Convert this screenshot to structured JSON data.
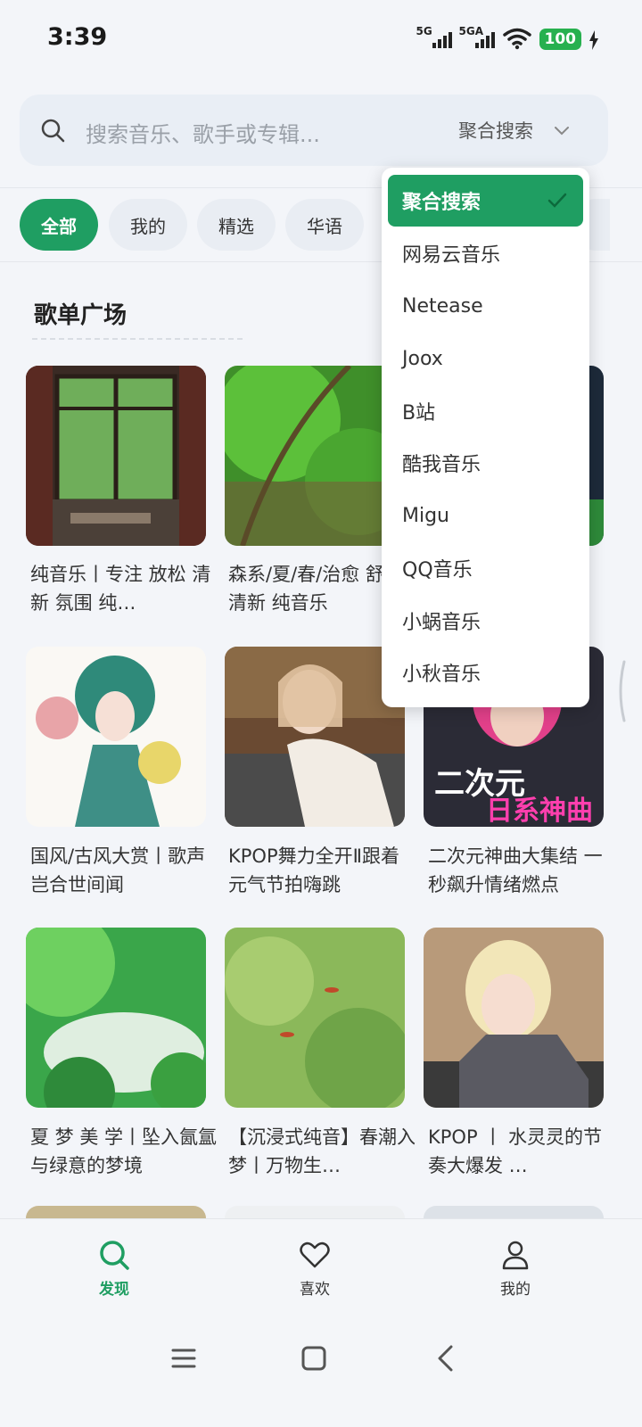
{
  "status_bar": {
    "time": "3:39",
    "signal_1_label": "5G",
    "signal_2_label": "5GA",
    "battery": "100",
    "icons": [
      "signal-icon",
      "signal-icon",
      "wifi-icon",
      "battery-icon",
      "charging-icon"
    ]
  },
  "search": {
    "placeholder": "搜索音乐、歌手或专辑...",
    "source_label": "聚合搜索"
  },
  "tabs": [
    "全部",
    "我的",
    "精选",
    "华语"
  ],
  "section": {
    "title": "歌单广场"
  },
  "playlists": [
    {
      "title": "纯音乐丨专注 放松 清新 氛围 纯…"
    },
    {
      "title": "森系/夏/春/治愈 舒缓 清新 纯音乐"
    },
    {
      "title": ""
    },
    {
      "title": "国风/古风大赏丨歌声岂合世间闻"
    },
    {
      "title": "KPOP舞力全开Ⅱ跟着元气节拍嗨跳"
    },
    {
      "title": "二次元神曲大集结 一秒飙升情绪燃点"
    },
    {
      "title": "夏 梦 美 学丨坠入氤氲与绿意的梦境"
    },
    {
      "title": "【沉浸式纯音】春潮入梦丨万物生…"
    },
    {
      "title": "KPOP 丨 水灵灵的节奏大爆发 …"
    }
  ],
  "cover_text": {
    "line1": "二次元",
    "line2": "日系神曲"
  },
  "dropdown": {
    "options": [
      "聚合搜索",
      "网易云音乐",
      "Netease",
      "Joox",
      "B站",
      "酷我音乐",
      "Migu",
      "QQ音乐",
      "小蜗音乐",
      "小秋音乐"
    ],
    "selected": "聚合搜索"
  },
  "bottom_nav": [
    {
      "label": "发现",
      "icon": "search-icon",
      "active": true
    },
    {
      "label": "喜欢",
      "icon": "heart-icon",
      "active": false
    },
    {
      "label": "我的",
      "icon": "user-icon",
      "active": false
    }
  ],
  "colors": {
    "accent": "#1f9e62",
    "background": "#f3f5f9"
  }
}
